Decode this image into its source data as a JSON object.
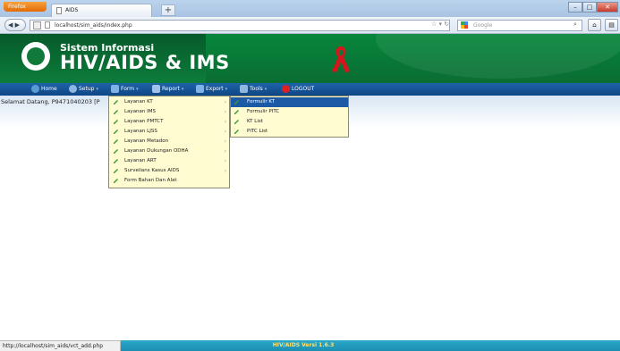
{
  "browser": {
    "app_button": "Firefox",
    "tab_title": "AIDS",
    "new_tab": "+",
    "url": "localhost/sim_aids/index.php",
    "search_placeholder": "Google",
    "status_url": "http://localhost/sim_aids/vct_add.php"
  },
  "header": {
    "subtitle": "Sistem Informasi",
    "title": "HIV/AIDS & IMS"
  },
  "menu": {
    "items": [
      {
        "label": "Home",
        "icon": "home-icon",
        "color": "#5b9bd5"
      },
      {
        "label": "Setup",
        "icon": "setup-icon",
        "color": "#8fb7e0"
      },
      {
        "label": "Form",
        "icon": "form-icon",
        "color": "#7fb2e5"
      },
      {
        "label": "Report",
        "icon": "report-icon",
        "color": "#9fc3ea"
      },
      {
        "label": "Export",
        "icon": "export-icon",
        "color": "#7fb2e5"
      },
      {
        "label": "Tools",
        "icon": "tools-icon",
        "color": "#8fb7e0"
      },
      {
        "label": "LOGOUT",
        "icon": "power-icon",
        "color": "#e02020"
      }
    ]
  },
  "welcome": "Selamat Datang, P9471040203 [P",
  "form_menu": {
    "items": [
      {
        "label": "Layanan KT",
        "has_sub": true
      },
      {
        "label": "Layanan IMS",
        "has_sub": true
      },
      {
        "label": "Layanan PMTCT",
        "has_sub": true
      },
      {
        "label": "Layanan LJSS",
        "has_sub": true
      },
      {
        "label": "Layanan Metadon",
        "has_sub": true
      },
      {
        "label": "Layanan Dukungan ODHA",
        "has_sub": true
      },
      {
        "label": "Layanan ART",
        "has_sub": true
      },
      {
        "label": "Surveilans Kasus AIDS",
        "has_sub": true
      },
      {
        "label": "Form Bahan Dan Alat",
        "has_sub": false
      }
    ]
  },
  "kt_submenu": {
    "items": [
      {
        "label": "Formulir KT",
        "selected": true
      },
      {
        "label": "Formulir PITC",
        "selected": false
      },
      {
        "label": "KT List",
        "selected": false
      },
      {
        "label": "PITC List",
        "selected": false
      }
    ]
  },
  "footer": {
    "version": "HIV/AIDS Versi 1.6.3"
  },
  "colors": {
    "header_green": "#0a7a38",
    "menu_blue": "#14549a",
    "dropdown_bg": "#fffcd2",
    "selected_bg": "#1c5aa6",
    "footer_bg": "#2aa8ca"
  }
}
